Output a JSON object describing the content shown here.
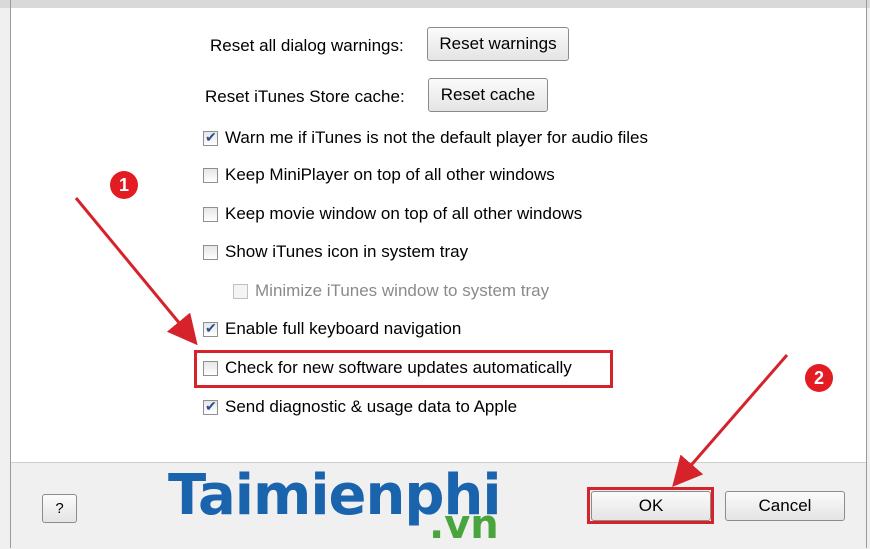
{
  "reset": {
    "dialog_label": "Reset all dialog warnings:",
    "dialog_button": "Reset warnings",
    "cache_label": "Reset iTunes Store cache:",
    "cache_button": "Reset cache"
  },
  "options": [
    {
      "label": "Warn me if iTunes is not the default player for audio files",
      "checked": true,
      "enabled": true
    },
    {
      "label": "Keep MiniPlayer on top of all other windows",
      "checked": false,
      "enabled": true
    },
    {
      "label": "Keep movie window on top of all other windows",
      "checked": false,
      "enabled": true
    },
    {
      "label": "Show iTunes icon in system tray",
      "checked": false,
      "enabled": true
    },
    {
      "label": "Minimize iTunes window to system tray",
      "checked": false,
      "enabled": false
    },
    {
      "label": "Enable full keyboard navigation",
      "checked": true,
      "enabled": true
    },
    {
      "label": "Check for new software updates automatically",
      "checked": false,
      "enabled": true
    },
    {
      "label": "Send diagnostic & usage data to Apple",
      "checked": true,
      "enabled": true
    }
  ],
  "footer": {
    "help_label": "?",
    "ok_label": "OK",
    "cancel_label": "Cancel"
  },
  "annotations": {
    "badge_1": "1",
    "badge_2": "2",
    "highlight_color": "#d6222a"
  },
  "watermark": {
    "brand": "Taimienphi",
    "suffix": ".vn"
  }
}
